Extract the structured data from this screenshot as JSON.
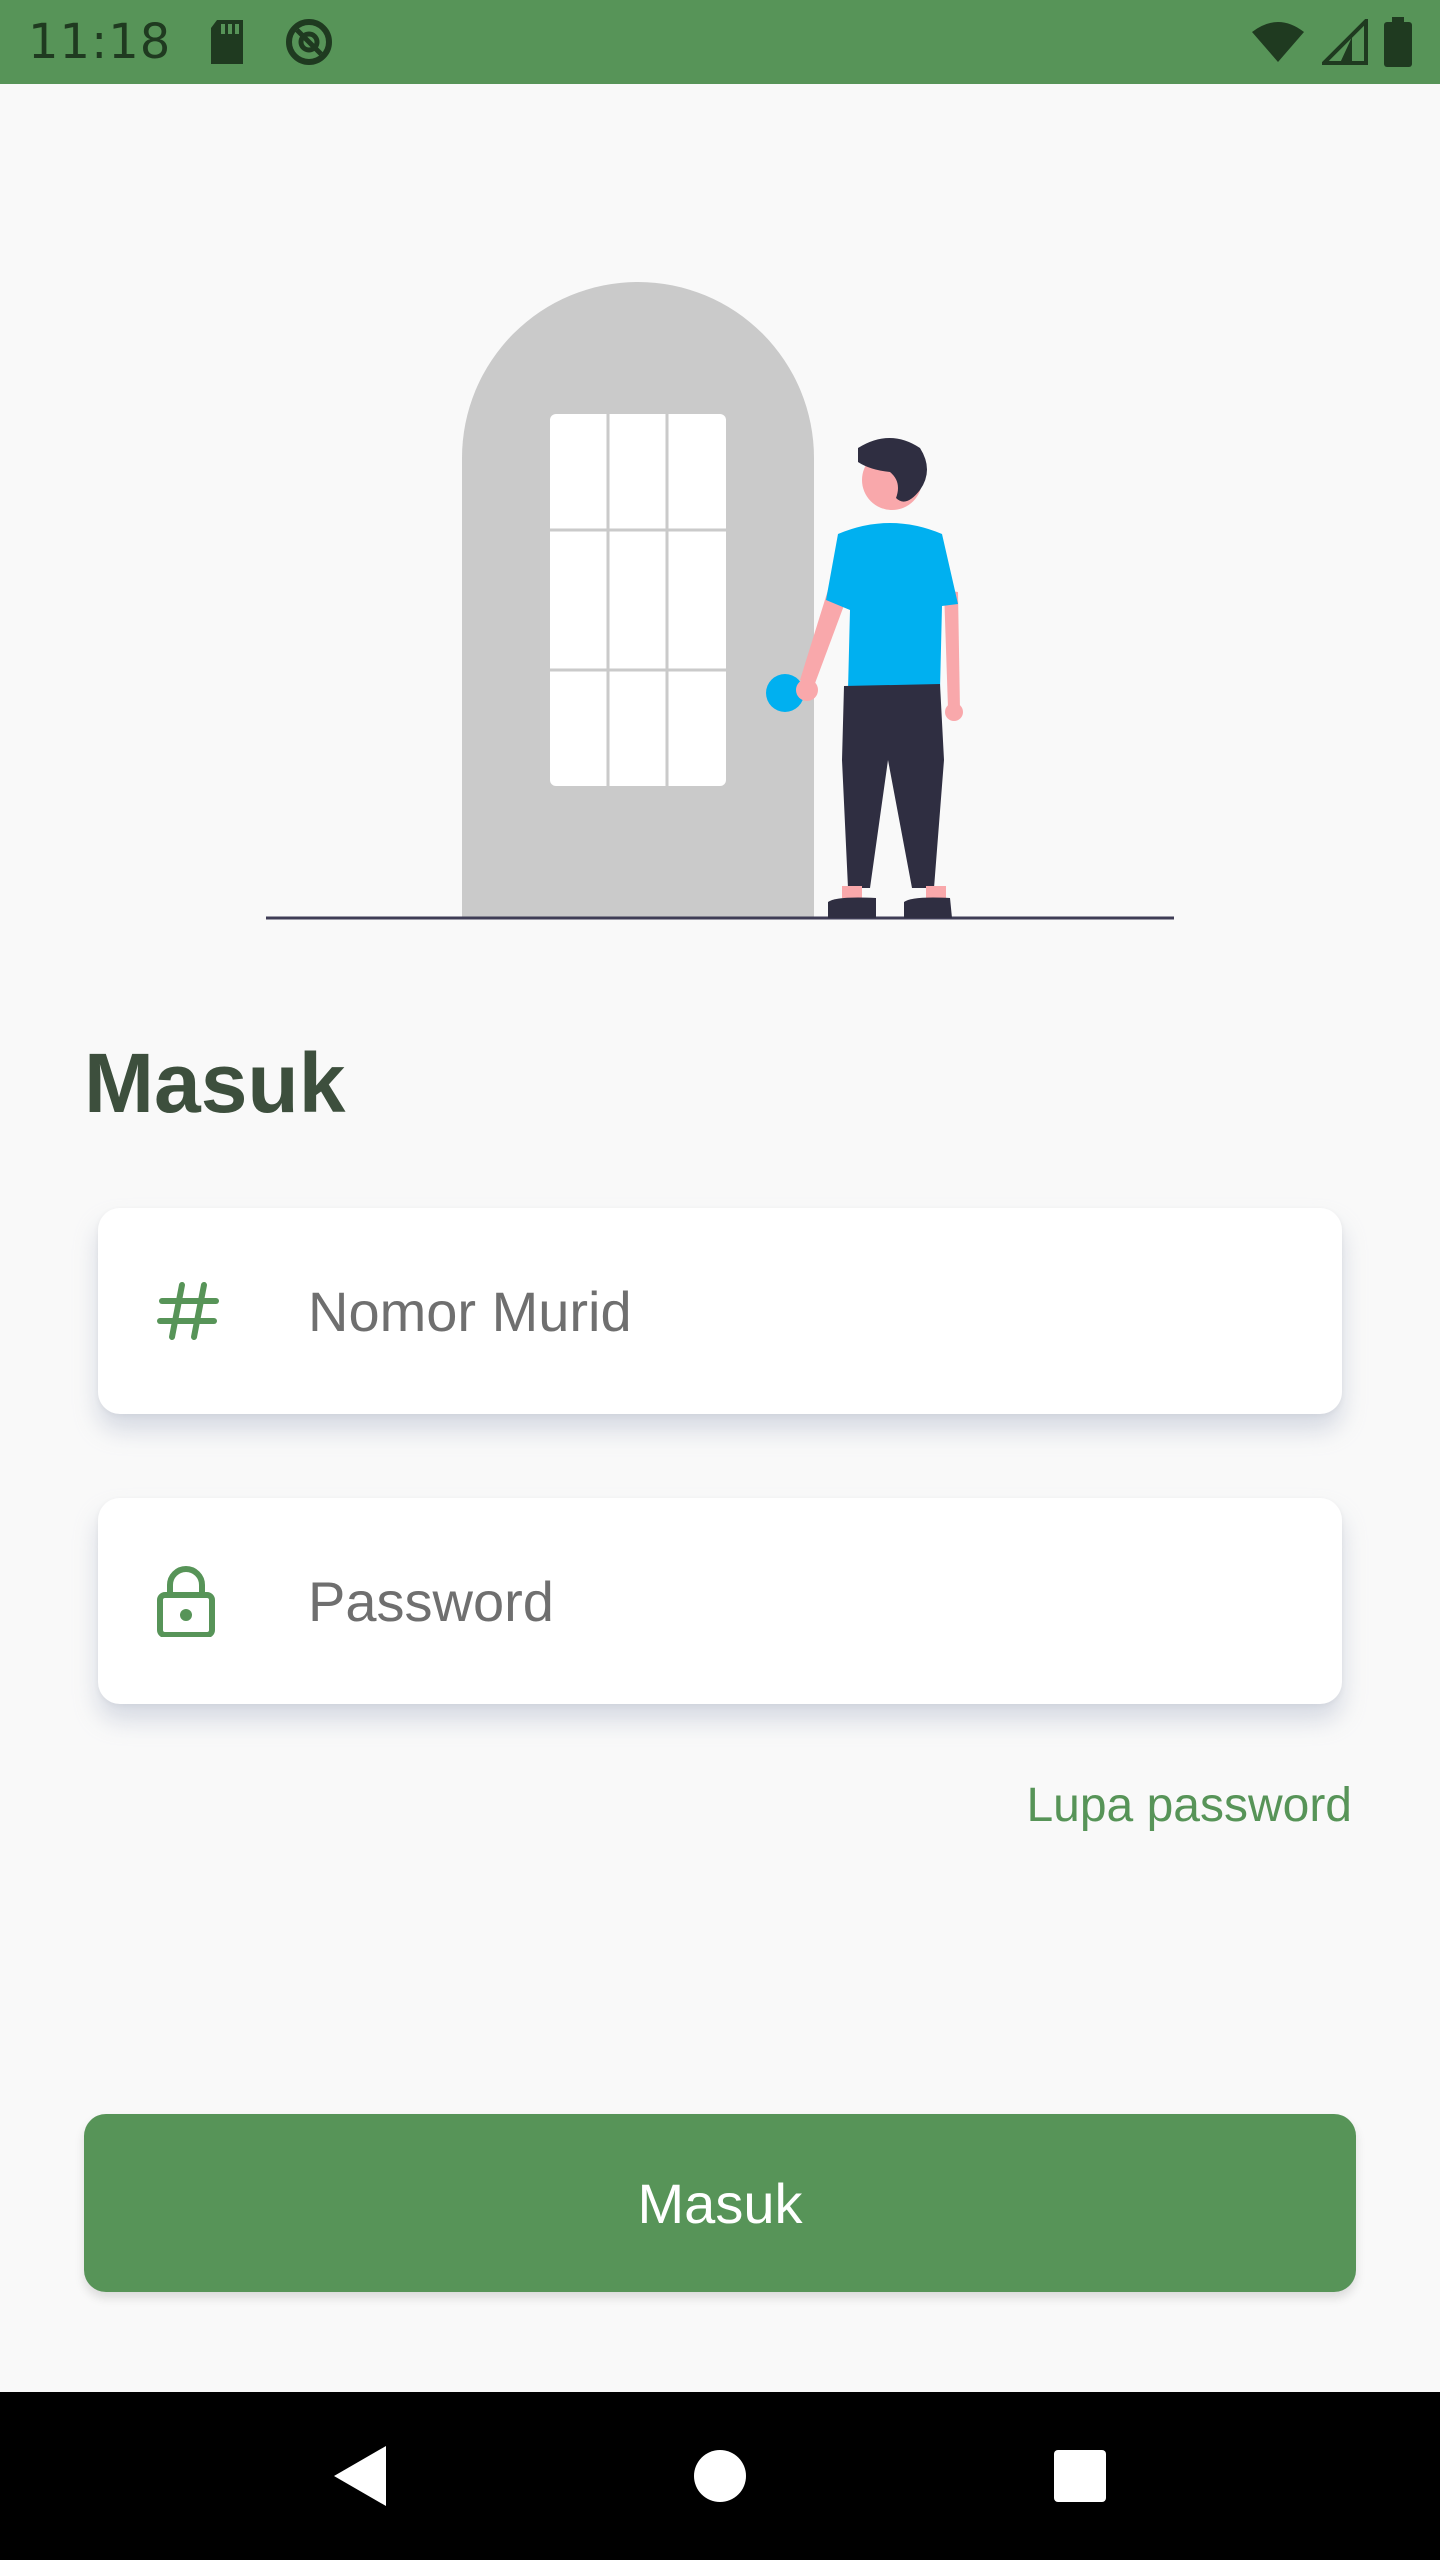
{
  "status_bar": {
    "time": "11:18",
    "icons": [
      "sd-card-icon",
      "data-saver-icon",
      "wifi-icon",
      "signal-icon",
      "battery-icon"
    ]
  },
  "login": {
    "title": "Masuk",
    "student_number_placeholder": "Nomor Murid",
    "password_placeholder": "Password",
    "forgot_password": "Lupa password",
    "submit_label": "Masuk"
  },
  "navigation": {
    "buttons": [
      "back-icon",
      "home-icon",
      "recents-icon"
    ]
  },
  "colors": {
    "primary": "#579458",
    "title": "#3d4f3d",
    "background": "#f9f9f9"
  }
}
